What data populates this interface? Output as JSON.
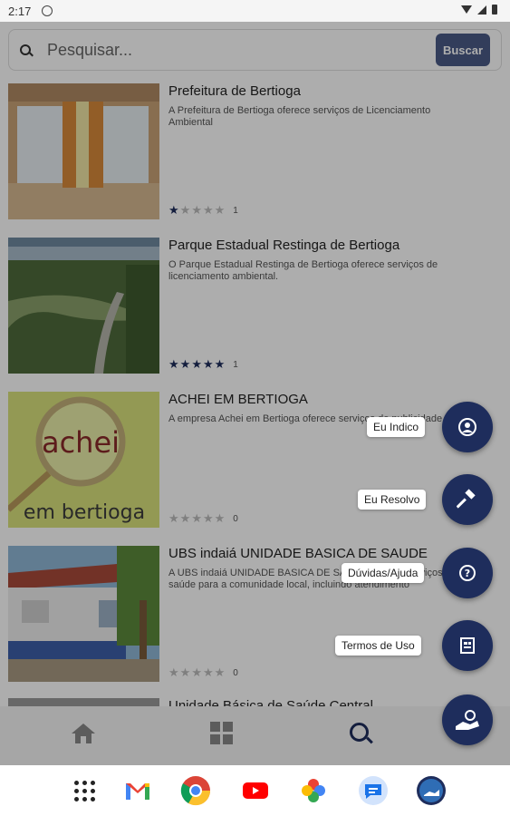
{
  "status": {
    "time": "2:17"
  },
  "search": {
    "placeholder": "Pesquisar...",
    "button_label": "Buscar"
  },
  "listings": [
    {
      "title": "Prefeitura de Bertioga",
      "description": "A Prefeitura de Bertioga oferece serviços de Licenciamento Ambiental",
      "rating": 1,
      "count": "1",
      "thumb": "building-photo"
    },
    {
      "title": "Parque Estadual Restinga de Bertioga",
      "description": "O Parque Estadual Restinga de Bertioga oferece serviços de licenciamento ambiental.",
      "rating": 5,
      "count": "1",
      "thumb": "aerial-photo"
    },
    {
      "title": "ACHEI EM BERTIOGA",
      "description": "A empresa Achei em Bertioga oferece serviços de publicidade",
      "rating": 0,
      "count": "0",
      "thumb": "achei-logo",
      "logo_word1": "achei",
      "logo_word2": "em bertioga"
    },
    {
      "title": "UBS indaiá UNIDADE BASICA DE SAUDE",
      "description": "A UBS indaiá UNIDADE BASICA DE SAUDE oferece serviços de saúde para a comunidade local, incluindo atendimento",
      "rating": 0,
      "count": "0",
      "thumb": "clinic-photo"
    },
    {
      "title": "Unidade Básica de Saúde Central",
      "description": "",
      "rating": 0,
      "count": "",
      "thumb": "photo"
    }
  ],
  "fab_menu": [
    {
      "label": "Eu Indico",
      "icon": "person-circle-icon"
    },
    {
      "label": "Eu Resolvo",
      "icon": "hammer-icon"
    },
    {
      "label": "Dúvidas/Ajuda",
      "icon": "help-circle-icon"
    },
    {
      "label": "Termos de Uso",
      "icon": "document-icon"
    }
  ],
  "main_fab": {
    "icon": "handshake-icon"
  },
  "bottom_nav": {
    "items": [
      "home-icon",
      "grid-icon",
      "search-icon"
    ],
    "active": "search-icon"
  },
  "colors": {
    "primary": "#1e2d5c",
    "button": "#4a5a86",
    "star_on": "#1e2d5c",
    "star_off": "#bbbbbb"
  },
  "dock": [
    "apps-icon",
    "gmail-icon",
    "chrome-icon",
    "youtube-icon",
    "photos-icon",
    "messages-icon",
    "app-icon"
  ]
}
